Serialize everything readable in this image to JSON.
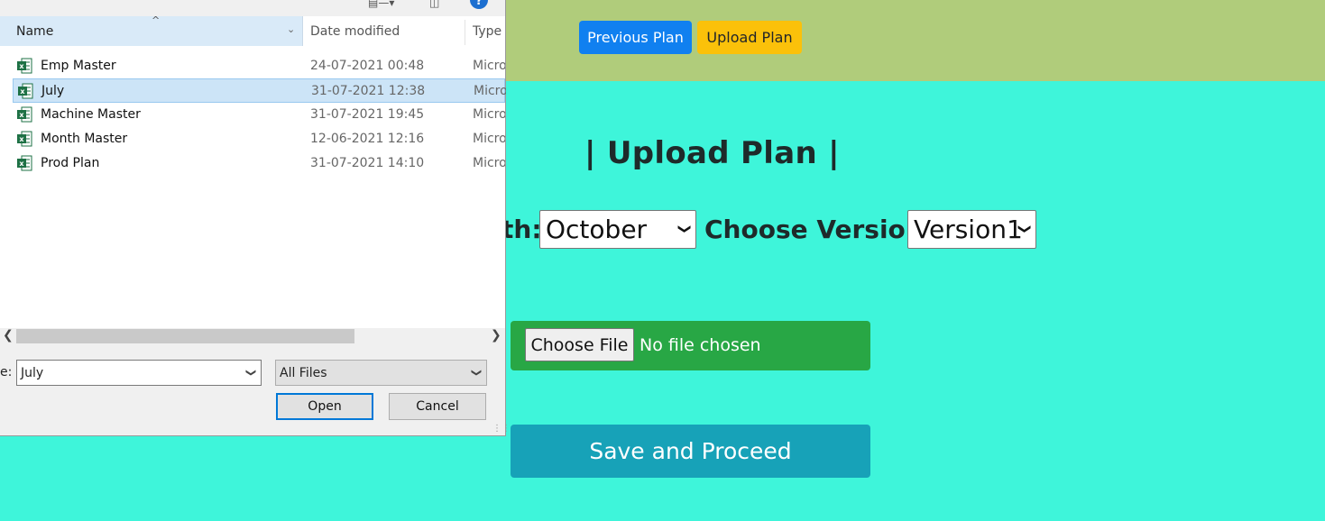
{
  "page": {
    "nav": {
      "previous_plan": "Previous Plan",
      "upload_plan": "Upload Plan"
    },
    "title": "| Upload Plan |",
    "month_label_partial": "th:",
    "month_value": "October",
    "version_label": "Choose Version:",
    "version_value": "Version1",
    "choose_file": "Choose File",
    "no_file": "No file chosen",
    "save_button": "Save and Proceed",
    "colors": {
      "background": "#3ef5da",
      "topbar": "#b0cc7b",
      "primary": "#1080f0",
      "warning": "#fbc10a",
      "success": "#28a745",
      "info": "#17a2b8"
    }
  },
  "dialog": {
    "columns": {
      "name": "Name",
      "date": "Date modified",
      "type": "Type"
    },
    "files": [
      {
        "name": "Emp Master",
        "date": "24-07-2021 00:48",
        "type": "Micro"
      },
      {
        "name": "July",
        "date": "31-07-2021 12:38",
        "type": "Micro"
      },
      {
        "name": "Machine Master",
        "date": "31-07-2021 19:45",
        "type": "Micro"
      },
      {
        "name": "Month Master",
        "date": "12-06-2021 12:16",
        "type": "Micro"
      },
      {
        "name": "Prod Plan",
        "date": "31-07-2021 14:10",
        "type": "Micro"
      }
    ],
    "selected_index": 1,
    "filename_label": "e:",
    "filename_value": "July",
    "filetype_value": "All Files",
    "open": "Open",
    "cancel": "Cancel",
    "icons": [
      "excel-file-icon",
      "help-icon",
      "view-icon",
      "preview-pane-icon"
    ]
  }
}
